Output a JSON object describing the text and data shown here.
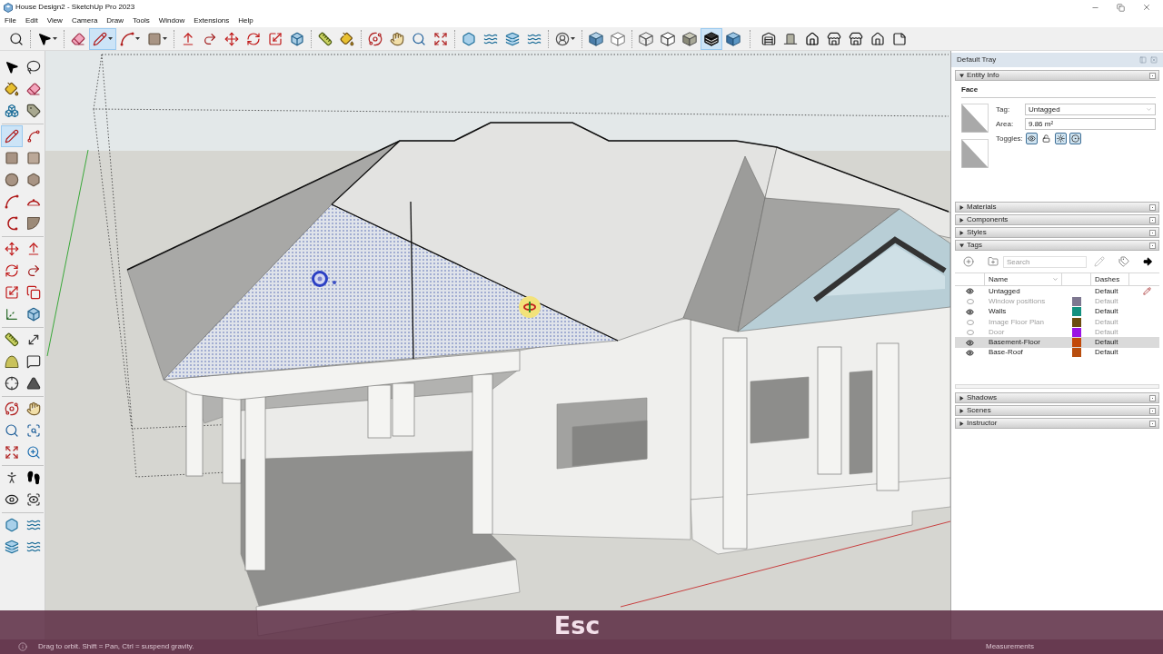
{
  "window": {
    "title": "House Design2 - SketchUp Pro 2023"
  },
  "menu_bar": [
    "File",
    "Edit",
    "View",
    "Camera",
    "Draw",
    "Tools",
    "Window",
    "Extensions",
    "Help"
  ],
  "toolbar": [
    [
      {
        "kind": "search",
        "selected": false
      }
    ],
    [
      {
        "kind": "select",
        "selected": false
      }
    ],
    [
      {
        "kind": "eraser",
        "selected": false
      },
      {
        "kind": "pencil",
        "selected": true
      },
      {
        "kind": "arc",
        "selected": false
      },
      {
        "kind": "rectangle",
        "selected": false
      }
    ],
    [
      {
        "kind": "pushpull",
        "selected": false
      },
      {
        "kind": "followme",
        "selected": false
      },
      {
        "kind": "move",
        "selected": false
      },
      {
        "kind": "rotate",
        "selected": false
      },
      {
        "kind": "scale",
        "selected": false
      },
      {
        "kind": "solid",
        "selected": false
      }
    ],
    [
      {
        "kind": "tape",
        "selected": false
      },
      {
        "kind": "paint",
        "selected": false
      }
    ],
    [
      {
        "kind": "orbit",
        "selected": false
      },
      {
        "kind": "pan",
        "selected": false
      },
      {
        "kind": "zoom",
        "selected": false
      },
      {
        "kind": "zoomextents",
        "selected": false
      }
    ],
    [
      {
        "kind": "hexcube",
        "selected": false
      },
      {
        "kind": "waves",
        "selected": false
      },
      {
        "kind": "stack",
        "selected": false
      },
      {
        "kind": "waves",
        "selected": false
      }
    ],
    [
      {
        "kind": "user",
        "selected": false
      }
    ],
    [
      {
        "kind": "iso",
        "selected": false
      },
      {
        "kind": "outline",
        "selected": false
      }
    ],
    [
      {
        "kind": "xray",
        "selected": false
      },
      {
        "kind": "hidden",
        "selected": false
      },
      {
        "kind": "shaded",
        "selected": false
      },
      {
        "kind": "textured",
        "selected": true
      },
      {
        "kind": "mono",
        "selected": false
      }
    ],
    [
      {
        "kind": "warehouse",
        "selected": false
      },
      {
        "kind": "extension",
        "selected": false
      },
      {
        "kind": "house",
        "selected": false
      },
      {
        "kind": "store",
        "selected": false
      },
      {
        "kind": "store",
        "selected": false
      },
      {
        "kind": "houseoutline",
        "selected": false
      },
      {
        "kind": "page",
        "selected": false
      }
    ]
  ],
  "tool_palette": [
    [
      {
        "kind": "select",
        "selected": false
      },
      {
        "kind": "lasso",
        "selected": false
      },
      {
        "kind": "paint",
        "selected": false
      },
      {
        "kind": "eraser",
        "selected": false
      },
      {
        "kind": "component",
        "selected": false
      },
      {
        "kind": "tag",
        "selected": false
      }
    ],
    [
      {
        "kind": "pencil",
        "selected": true
      },
      {
        "kind": "freehand",
        "selected": false
      },
      {
        "kind": "rectangle",
        "selected": false
      },
      {
        "kind": "rotated",
        "selected": false
      },
      {
        "kind": "circle",
        "selected": false
      },
      {
        "kind": "polygon",
        "selected": false
      },
      {
        "kind": "arc",
        "selected": false
      },
      {
        "kind": "arc3",
        "selected": false
      },
      {
        "kind": "arc2",
        "selected": false
      },
      {
        "kind": "pie",
        "selected": false
      }
    ],
    [
      {
        "kind": "move",
        "selected": false
      },
      {
        "kind": "pushpull",
        "selected": false
      },
      {
        "kind": "rotate",
        "selected": false
      },
      {
        "kind": "followme",
        "selected": false
      },
      {
        "kind": "scale",
        "selected": false
      },
      {
        "kind": "offset",
        "selected": false
      },
      {
        "kind": "axes",
        "selected": false
      },
      {
        "kind": "solid",
        "selected": false
      }
    ],
    [
      {
        "kind": "tape",
        "selected": false
      },
      {
        "kind": "dimension",
        "selected": false
      },
      {
        "kind": "protractor",
        "selected": false
      },
      {
        "kind": "text",
        "selected": false
      },
      {
        "kind": "crosshair",
        "selected": false
      },
      {
        "kind": "text3d",
        "selected": false
      }
    ],
    [
      {
        "kind": "orbit",
        "selected": false
      },
      {
        "kind": "pan",
        "selected": false
      },
      {
        "kind": "zoom",
        "selected": false
      },
      {
        "kind": "zoomwindow",
        "selected": false
      },
      {
        "kind": "zoomextents",
        "selected": false
      },
      {
        "kind": "previous",
        "selected": false
      }
    ],
    [
      {
        "kind": "position",
        "selected": false
      },
      {
        "kind": "walk",
        "selected": false
      },
      {
        "kind": "lookaround",
        "selected": false
      },
      {
        "kind": "section",
        "selected": false
      }
    ],
    [
      {
        "kind": "hexcube",
        "selected": false
      },
      {
        "kind": "waves",
        "selected": false
      },
      {
        "kind": "stack",
        "selected": false
      },
      {
        "kind": "waves",
        "selected": false
      }
    ]
  ],
  "tray": {
    "title": "Default Tray",
    "panels": [
      {
        "kind": "entity_info",
        "title": "Entity Info",
        "expanded": true,
        "entity": "Face",
        "tag_label": "Tag:",
        "tag": "Untagged",
        "area_label": "Area:",
        "area": "9.86 m²",
        "toggles_label": "Toggles:",
        "toggles": [
          {
            "kind": "visible",
            "on": true
          },
          {
            "kind": "locked",
            "on": false
          },
          {
            "kind": "cast_shadows",
            "on": true
          },
          {
            "kind": "receive_shadows",
            "on": true
          }
        ]
      },
      {
        "title": "Materials",
        "expanded": false
      },
      {
        "title": "Components",
        "expanded": false
      },
      {
        "title": "Styles",
        "expanded": false
      },
      {
        "kind": "tags",
        "title": "Tags",
        "expanded": true,
        "search": {
          "placeholder": "Search"
        },
        "columns": [
          "Name",
          "Dashes"
        ],
        "rows": [
          {
            "name": "Untagged",
            "visible": true,
            "active": true,
            "dashes": "Default",
            "selected": false
          },
          {
            "name": "Window positions",
            "visible": false,
            "active": false,
            "color": "#7d7790",
            "dashes": "Default",
            "selected": false
          },
          {
            "name": "Walls",
            "visible": true,
            "active": false,
            "color": "#13907f",
            "dashes": "Default",
            "selected": false
          },
          {
            "name": "Image Floor Plan",
            "visible": false,
            "active": false,
            "color": "#6b4c0f",
            "dashes": "Default",
            "selected": false
          },
          {
            "name": "Door",
            "visible": false,
            "active": false,
            "color": "#9a12e6",
            "dashes": "Default",
            "selected": false
          },
          {
            "name": "Basement-Floor",
            "visible": true,
            "active": false,
            "color": "#c24808",
            "dashes": "Default",
            "selected": true
          },
          {
            "name": "Base-Roof",
            "visible": true,
            "active": false,
            "color": "#b84e0e",
            "dashes": "Default",
            "selected": false
          }
        ]
      },
      {
        "title": "Shadows",
        "expanded": false
      },
      {
        "title": "Scenes",
        "expanded": false
      },
      {
        "title": "Instructor",
        "expanded": false
      }
    ]
  },
  "status_bar": {
    "hint": "Drag to orbit. Shift = Pan, Ctrl = suspend gravity.",
    "measurements_label": "Measurements"
  },
  "key_overlay": {
    "key": "Esc"
  }
}
